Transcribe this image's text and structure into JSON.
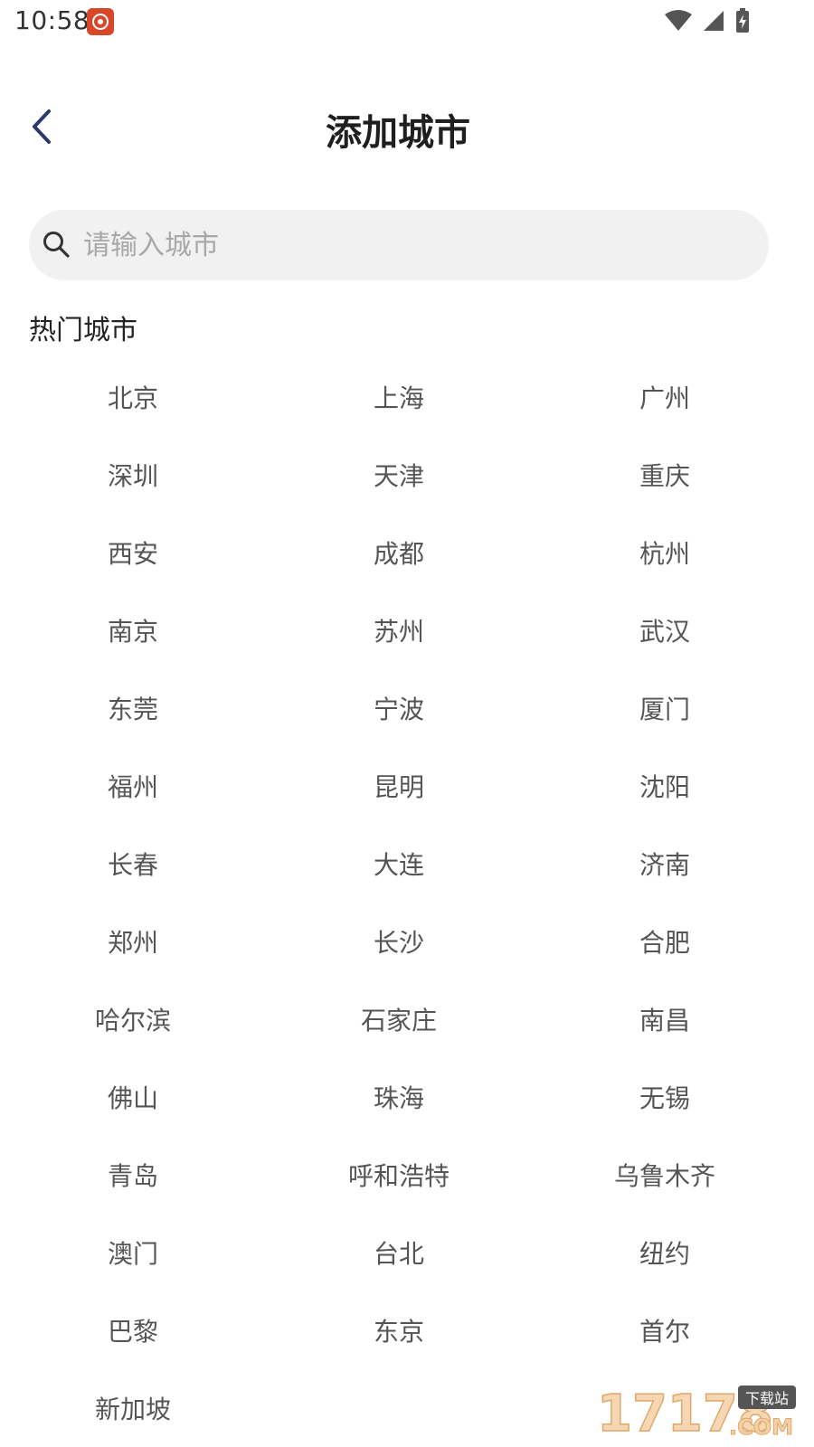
{
  "status_bar": {
    "time": "10:58"
  },
  "header": {
    "title": "添加城市"
  },
  "search": {
    "placeholder": "请输入城市",
    "value": ""
  },
  "hot_cities": {
    "heading": "热门城市",
    "cities": [
      "北京",
      "上海",
      "广州",
      "深圳",
      "天津",
      "重庆",
      "西安",
      "成都",
      "杭州",
      "南京",
      "苏州",
      "武汉",
      "东莞",
      "宁波",
      "厦门",
      "福州",
      "昆明",
      "沈阳",
      "长春",
      "大连",
      "济南",
      "郑州",
      "长沙",
      "合肥",
      "哈尔滨",
      "石家庄",
      "南昌",
      "佛山",
      "珠海",
      "无锡",
      "青岛",
      "呼和浩特",
      "乌鲁木齐",
      "澳门",
      "台北",
      "纽约",
      "巴黎",
      "东京",
      "首尔",
      "新加坡"
    ]
  },
  "watermark": {
    "text": "17178",
    "suffix": ".COM",
    "badge": "下载站"
  },
  "colors": {
    "accent": "#2b3a6b",
    "search_bg": "#f1f1f1",
    "city_text": "#555555"
  }
}
